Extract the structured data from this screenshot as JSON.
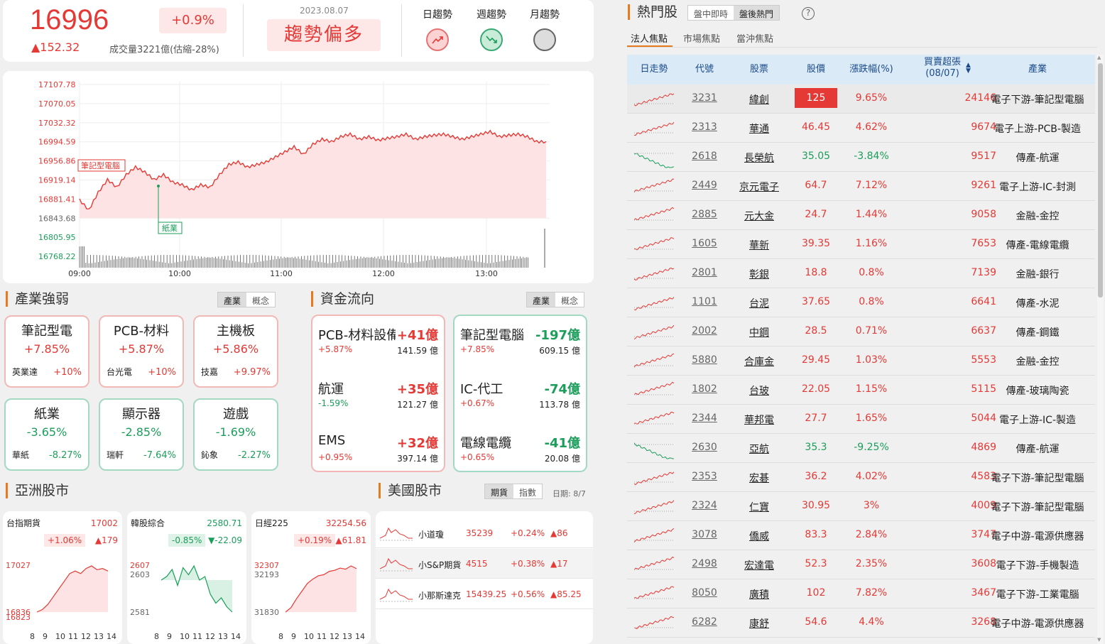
{
  "index": {
    "value": "16996",
    "change_pct": "+0.9%",
    "change_pts": "▲152.32",
    "volume": "成交量3221億(估縮-28%)",
    "date": "2023.08.07",
    "trend": "趨勢偏多"
  },
  "trends": [
    {
      "label": "日趨勢",
      "state": "up"
    },
    {
      "label": "週趨勢",
      "state": "down"
    },
    {
      "label": "月趨勢",
      "state": "neutral"
    }
  ],
  "chart_data": {
    "type": "line",
    "x_ticks": [
      "09:00",
      "10:00",
      "11:00",
      "12:00",
      "13:00"
    ],
    "y_ticks": [
      "17107.78",
      "17070.05",
      "17032.32",
      "16994.59",
      "16956.86",
      "16919.14",
      "16881.41",
      "16843.68",
      "16805.95",
      "16768.22"
    ],
    "ylim": [
      16768.22,
      17107.78
    ],
    "prev_close": 16843.68,
    "series": [
      {
        "values": [
          16880,
          16860,
          16895,
          16920,
          16905,
          16930,
          16945,
          16935,
          16920,
          16930,
          16915,
          16910,
          16900,
          16910,
          16905,
          16930,
          16950,
          16955,
          16945,
          16950,
          16955,
          16965,
          16975,
          16985,
          16970,
          16990,
          17000,
          16995,
          17005,
          17010,
          17000,
          17005,
          16998,
          17002,
          17005,
          17010,
          17000,
          17005,
          17008,
          17010,
          17005,
          17000,
          17005,
          17010,
          17015,
          17005,
          17008,
          17010,
          17005,
          16995,
          16995
        ]
      }
    ],
    "annotations": [
      {
        "label": "筆記型電腦",
        "color": "#e53935"
      },
      {
        "label": "紙業",
        "color": "#1b9e5a"
      }
    ]
  },
  "industry": {
    "title": "產業強弱",
    "tabs": [
      "產業",
      "概念"
    ],
    "items": [
      {
        "name": "筆記型電",
        "pct": "+7.85%",
        "stock": "英業達",
        "stock_pct": "+10%",
        "dir": "up"
      },
      {
        "name": "PCB-材料",
        "pct": "+5.87%",
        "stock": "台光電",
        "stock_pct": "+10%",
        "dir": "up"
      },
      {
        "name": "主機板",
        "pct": "+5.86%",
        "stock": "技嘉",
        "stock_pct": "+9.97%",
        "dir": "up"
      },
      {
        "name": "紙業",
        "pct": "-3.65%",
        "stock": "華紙",
        "stock_pct": "-8.27%",
        "dir": "dn"
      },
      {
        "name": "顯示器",
        "pct": "-2.85%",
        "stock": "瑞軒",
        "stock_pct": "-7.64%",
        "dir": "dn"
      },
      {
        "name": "遊戲",
        "pct": "-1.69%",
        "stock": "鈊象",
        "stock_pct": "-2.27%",
        "dir": "dn"
      }
    ]
  },
  "flow": {
    "title": "資金流向",
    "tabs": [
      "產業",
      "概念"
    ],
    "inflow": [
      {
        "name": "PCB-材料設備",
        "val": "+41億",
        "pct": "+5.87%",
        "amt": "141.59 億"
      },
      {
        "name": "航運",
        "val": "+35億",
        "pct": "-1.59%",
        "amt": "121.27 億"
      },
      {
        "name": "EMS",
        "val": "+32億",
        "pct": "+0.95%",
        "amt": "397.14 億"
      }
    ],
    "outflow": [
      {
        "name": "筆記型電腦",
        "val": "-197億",
        "pct": "+7.85%",
        "amt": "609.15 億"
      },
      {
        "name": "IC-代工",
        "val": "-74億",
        "pct": "+0.67%",
        "amt": "113.78 億"
      },
      {
        "name": "電線電纜",
        "val": "-41億",
        "pct": "+0.65%",
        "amt": "20.08 億"
      }
    ]
  },
  "asia": {
    "title": "亞洲股市",
    "markets": [
      {
        "name": "台指期貨",
        "value": "17002",
        "pct": "+1.06%",
        "chg": "▲179",
        "y_hi": "17027",
        "y_lo": "16836",
        "y_lo2": "16823",
        "x": [
          "8",
          "9",
          "10",
          "11",
          "12",
          "13",
          "14"
        ],
        "dir": "up",
        "values": [
          16840,
          16850,
          16870,
          16900,
          16930,
          16960,
          16990,
          17000,
          16990,
          17010,
          17020,
          17005,
          17010,
          17000
        ]
      },
      {
        "name": "韓股綜合",
        "value": "2580.71",
        "pct": "-0.85%",
        "chg": "▼-22.09",
        "y_hi": "2607",
        "y_mid": "2603",
        "y_lo": "2581",
        "x": [
          "8",
          "9",
          "10",
          "11",
          "12",
          "13",
          "14"
        ],
        "dir": "dn",
        "values": [
          2598,
          2600,
          2604,
          2595,
          2605,
          2601,
          2606,
          2598,
          2600,
          2590,
          2585,
          2588,
          2583,
          2580
        ]
      },
      {
        "name": "日經225",
        "value": "32254.56",
        "pct": "+0.19%",
        "chg": "▲61.81",
        "y_hi": "32307",
        "y_mid": "32193",
        "y_lo": "31830",
        "x": [
          "8",
          "9",
          "10",
          "11",
          "12",
          "13",
          "14"
        ],
        "dir": "up",
        "values": [
          31860,
          31900,
          31980,
          32050,
          32120,
          32160,
          32190,
          32200,
          32230,
          32240,
          32260,
          32250,
          32280,
          32255
        ]
      }
    ]
  },
  "us": {
    "title": "美國股市",
    "tabs": [
      "期貨",
      "指數"
    ],
    "date": "日期: 8/7",
    "rows": [
      {
        "name": "小道瓊",
        "price": "35239",
        "pct": "+0.24%",
        "chg": "▲86"
      },
      {
        "name": "小S&P期貨",
        "price": "4515",
        "pct": "+0.38%",
        "chg": "▲17"
      },
      {
        "name": "小那斯達克",
        "price": "15439.25",
        "pct": "+0.56%",
        "chg": "▲85.25"
      }
    ]
  },
  "hot": {
    "title": "熱門股",
    "modes": [
      "盤中即時",
      "盤後熱門"
    ],
    "subtabs": [
      "法人焦點",
      "市場焦點",
      "當沖焦點"
    ],
    "headers": [
      "日走勢",
      "代號",
      "股票",
      "股價",
      "漲跌幅(%)",
      "買賣超張",
      "(08/07)",
      "產業"
    ],
    "rows": [
      {
        "code": "3231",
        "name": "緯創",
        "price": "125",
        "chg": "9.65%",
        "net": "24146",
        "ind": "電子下游-筆記型電腦",
        "dir": "limit"
      },
      {
        "code": "2313",
        "name": "華通",
        "price": "46.45",
        "chg": "4.62%",
        "net": "9674",
        "ind": "電子上游-PCB-製造",
        "dir": "up"
      },
      {
        "code": "2618",
        "name": "長榮航",
        "price": "35.05",
        "chg": "-3.84%",
        "net": "9517",
        "ind": "傳產-航運",
        "dir": "dn"
      },
      {
        "code": "2449",
        "name": "京元電子",
        "price": "64.7",
        "chg": "7.12%",
        "net": "9261",
        "ind": "電子上游-IC-封測",
        "dir": "up"
      },
      {
        "code": "2885",
        "name": "元大金",
        "price": "24.7",
        "chg": "1.44%",
        "net": "9058",
        "ind": "金融-金控",
        "dir": "up"
      },
      {
        "code": "1605",
        "name": "華新",
        "price": "39.35",
        "chg": "1.16%",
        "net": "7653",
        "ind": "傳產-電線電纜",
        "dir": "up"
      },
      {
        "code": "2801",
        "name": "彰銀",
        "price": "18.8",
        "chg": "0.8%",
        "net": "7139",
        "ind": "金融-銀行",
        "dir": "up"
      },
      {
        "code": "1101",
        "name": "台泥",
        "price": "37.65",
        "chg": "0.8%",
        "net": "6641",
        "ind": "傳產-水泥",
        "dir": "up"
      },
      {
        "code": "2002",
        "name": "中鋼",
        "price": "28.5",
        "chg": "0.71%",
        "net": "6637",
        "ind": "傳產-鋼鐵",
        "dir": "up"
      },
      {
        "code": "5880",
        "name": "合庫金",
        "price": "29.45",
        "chg": "1.03%",
        "net": "5553",
        "ind": "金融-金控",
        "dir": "up"
      },
      {
        "code": "1802",
        "name": "台玻",
        "price": "22.05",
        "chg": "1.15%",
        "net": "5115",
        "ind": "傳產-玻璃陶瓷",
        "dir": "up"
      },
      {
        "code": "2344",
        "name": "華邦電",
        "price": "27.7",
        "chg": "1.65%",
        "net": "5044",
        "ind": "電子上游-IC-製造",
        "dir": "up"
      },
      {
        "code": "2630",
        "name": "亞航",
        "price": "35.3",
        "chg": "-9.25%",
        "net": "4869",
        "ind": "傳產-航運",
        "dir": "dn"
      },
      {
        "code": "2353",
        "name": "宏碁",
        "price": "36.2",
        "chg": "4.02%",
        "net": "4583",
        "ind": "電子下游-筆記型電腦",
        "dir": "up"
      },
      {
        "code": "2324",
        "name": "仁寶",
        "price": "30.95",
        "chg": "3%",
        "net": "4009",
        "ind": "電子下游-筆記型電腦",
        "dir": "up"
      },
      {
        "code": "3078",
        "name": "僑威",
        "price": "83.3",
        "chg": "2.84%",
        "net": "3747",
        "ind": "電子中游-電源供應器",
        "dir": "up"
      },
      {
        "code": "2498",
        "name": "宏達電",
        "price": "52.3",
        "chg": "2.35%",
        "net": "3608",
        "ind": "電子下游-手機製造",
        "dir": "up"
      },
      {
        "code": "8050",
        "name": "廣積",
        "price": "102",
        "chg": "7.82%",
        "net": "3467",
        "ind": "電子下游-工業電腦",
        "dir": "up"
      },
      {
        "code": "6282",
        "name": "康舒",
        "price": "54.6",
        "chg": "4.4%",
        "net": "3268",
        "ind": "電子中游-電源供應器",
        "dir": "up"
      }
    ]
  }
}
